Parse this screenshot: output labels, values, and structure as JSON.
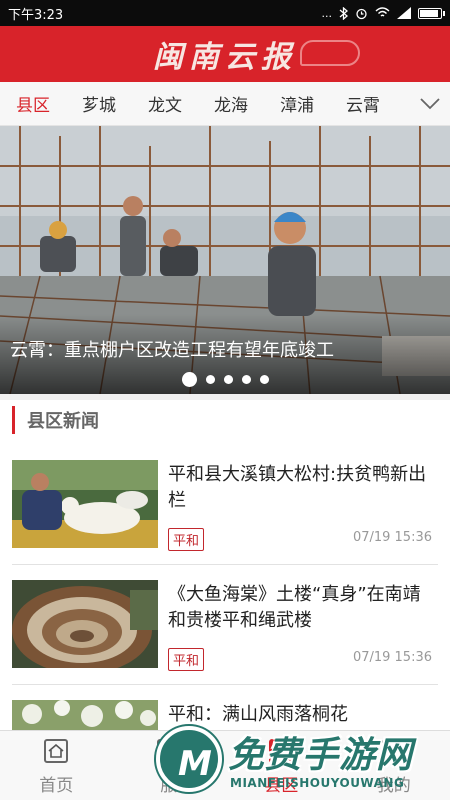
{
  "status": {
    "time": "下午3:23",
    "dots": "...",
    "signal_glyph": "▲"
  },
  "brand": {
    "title": "闽南云报"
  },
  "tabs": [
    "县区",
    "芗城",
    "龙文",
    "龙海",
    "漳浦",
    "云霄"
  ],
  "banner": {
    "caption": "云霄：重点棚户区改造工程有望年底竣工",
    "slide_count": 5,
    "active_slide": 1
  },
  "section": {
    "title": "县区新闻"
  },
  "news": [
    {
      "title": "平和县大溪镇大松村:扶贫鸭新出栏",
      "tag": "平和",
      "time": "07/19 15:36"
    },
    {
      "title": "《大鱼海棠》土楼“真身”在南靖和贵楼平和绳武楼",
      "tag": "平和",
      "time": "07/19 15:36"
    },
    {
      "title": "平和：满山风雨落桐花",
      "tag": "",
      "time": ""
    }
  ],
  "bottom_nav": [
    {
      "label": "首页",
      "icon": "home-icon"
    },
    {
      "label": "服",
      "icon": "service-icon"
    },
    {
      "label": "县区",
      "icon": "county-icon"
    },
    {
      "label": "我的",
      "icon": "profile-icon"
    }
  ],
  "watermark": {
    "text": "免费手游网",
    "sub": "MIANFEISHOUYOUWANG"
  },
  "colors": {
    "brand_red": "#d8232a",
    "watermark_green": "#27776d"
  }
}
